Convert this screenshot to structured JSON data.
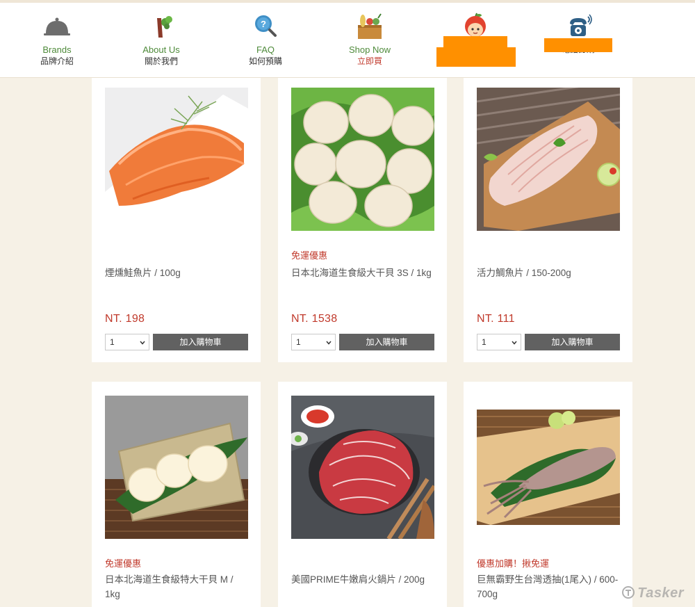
{
  "nav": {
    "items": [
      {
        "en": "Brands",
        "zh": "品牌介紹",
        "icon": "cloche-icon"
      },
      {
        "en": "About Us",
        "zh": "關於我們",
        "icon": "sprout-icon"
      },
      {
        "en": "FAQ",
        "zh": "如何預購",
        "icon": "question-magnifier-icon"
      },
      {
        "en": "Shop Now",
        "zh": "立即買",
        "icon": "grocery-box-icon"
      },
      {
        "en": "",
        "zh": "",
        "icon": "apple-mascot-icon"
      },
      {
        "en": "",
        "zh": "電話訂購",
        "icon": "telephone-icon"
      }
    ]
  },
  "products": [
    {
      "tag": "",
      "name": "煙燻鮭魚片 / 100g",
      "price": "NT. 198",
      "qty": "1",
      "cart_label": "加入購物車",
      "image": "smoked-salmon"
    },
    {
      "tag": "免運優惠",
      "name": "日本北海道生食級大干貝 3S / 1kg",
      "price": "NT. 1538",
      "qty": "1",
      "cart_label": "加入購物車",
      "image": "scallops"
    },
    {
      "tag": "",
      "name": "活力鯛魚片 / 150-200g",
      "price": "NT. 111",
      "qty": "1",
      "cart_label": "加入購物車",
      "image": "tilapia-fillet"
    },
    {
      "tag": "免運優惠",
      "name": "日本北海道生食級特大干貝 M / 1kg",
      "image": "scallops-on-leaf"
    },
    {
      "tag": "",
      "name": "美國PRIME牛嫩肩火鍋片 / 200g",
      "image": "beef-slices"
    },
    {
      "tag": "優惠加購！揪免運",
      "name": "巨無霸野生台灣透抽(1尾入) / 600-700g",
      "image": "squid"
    }
  ],
  "colors": {
    "accent_green": "#4e8a3a",
    "price_red": "#c0392b",
    "redaction": "#ff9000",
    "button_gray": "#616161"
  },
  "watermark": "Tasker"
}
